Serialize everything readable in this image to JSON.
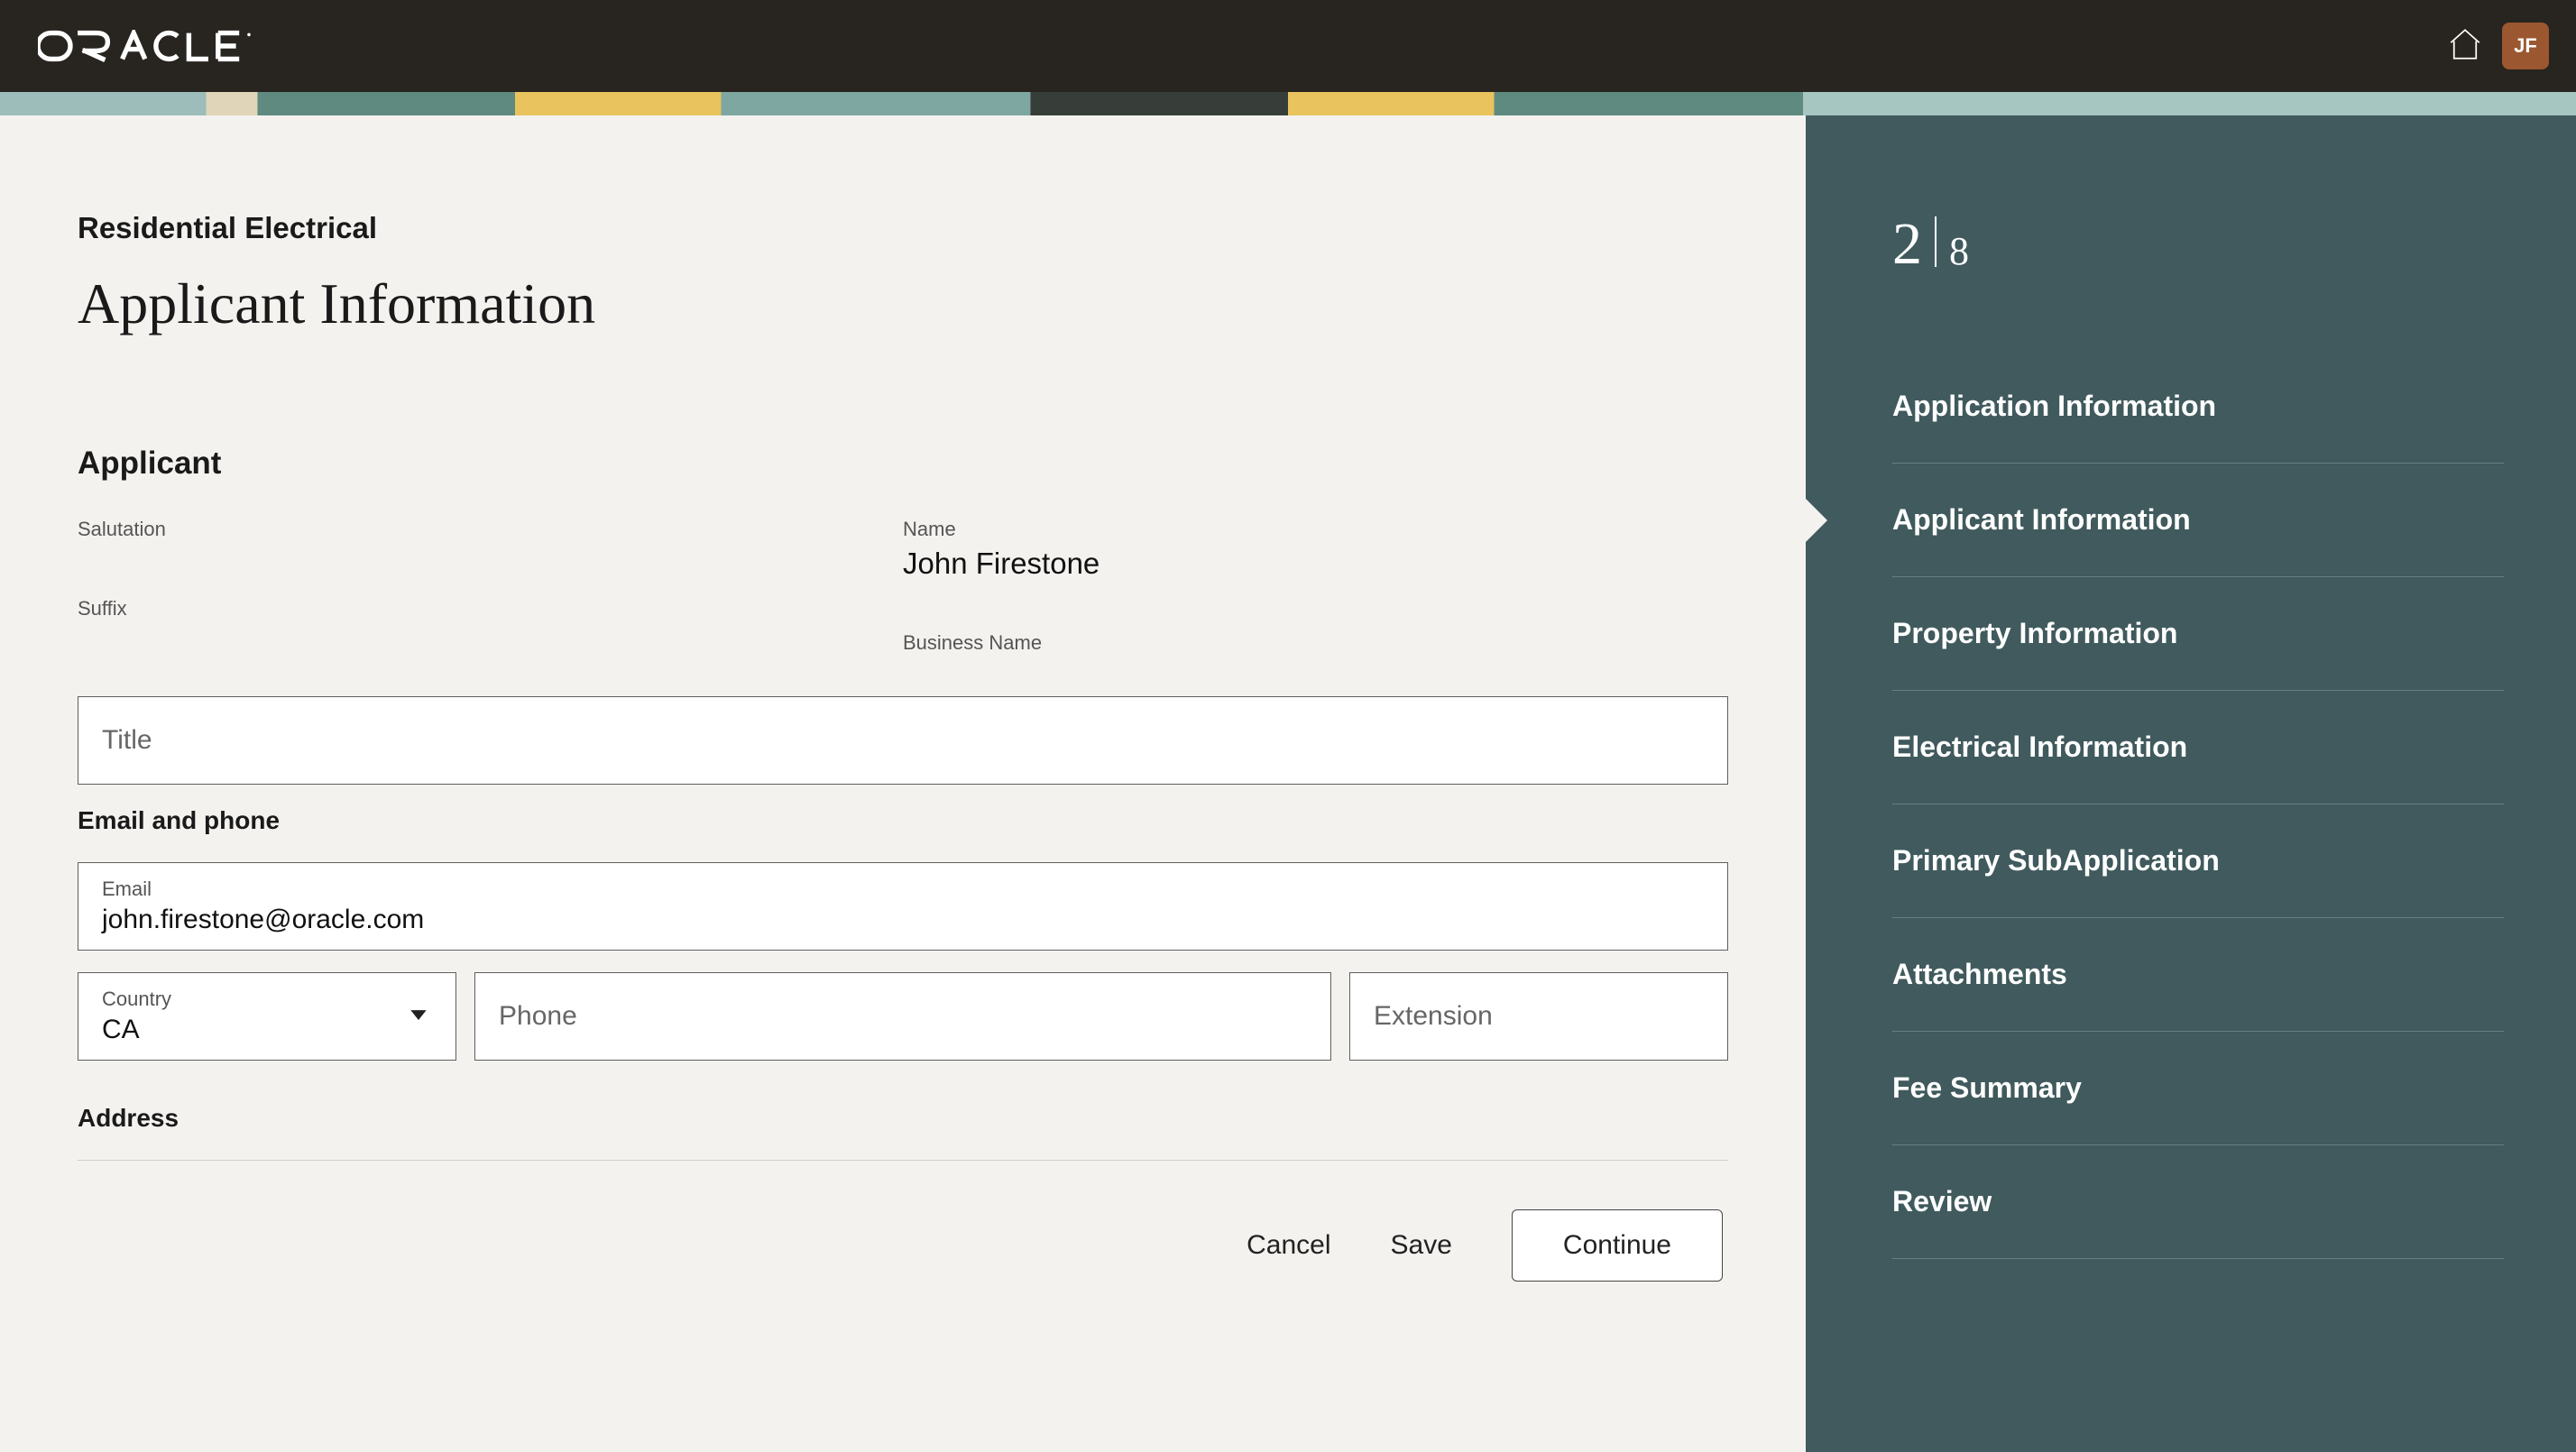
{
  "header": {
    "brand": "ORACLE",
    "avatar_initials": "JF"
  },
  "page": {
    "breadcrumb": "Residential Electrical",
    "title": "Applicant Information"
  },
  "applicant": {
    "section_label": "Applicant",
    "salutation_label": "Salutation",
    "salutation_value": "",
    "name_label": "Name",
    "name_value": "John Firestone",
    "suffix_label": "Suffix",
    "suffix_value": "",
    "business_label": "Business Name",
    "business_value": "",
    "title_label": "Title",
    "title_value": ""
  },
  "contact": {
    "section_label": "Email and phone",
    "email_label": "Email",
    "email_value": "john.firestone@oracle.com",
    "country_label": "Country",
    "country_value": "CA",
    "phone_label": "Phone",
    "phone_value": "",
    "extension_label": "Extension",
    "extension_value": ""
  },
  "address": {
    "section_label": "Address"
  },
  "actions": {
    "cancel": "Cancel",
    "save": "Save",
    "continue": "Continue"
  },
  "progress": {
    "current": "2",
    "total": "8",
    "steps": [
      "Application Information",
      "Applicant Information",
      "Property Information",
      "Electrical Information",
      "Primary SubApplication",
      "Attachments",
      "Fee Summary",
      "Review"
    ],
    "active_index": 1
  }
}
